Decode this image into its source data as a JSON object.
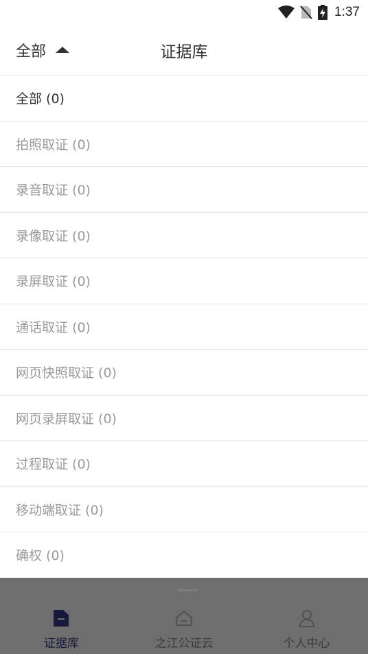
{
  "status_bar": {
    "time": "1:37"
  },
  "header": {
    "filter_label": "全部",
    "title": "证据库"
  },
  "filter_options": [
    {
      "label": "全部 (0)",
      "active": true
    },
    {
      "label": "拍照取证 (0)",
      "active": false
    },
    {
      "label": "录音取证 (0)",
      "active": false
    },
    {
      "label": "录像取证 (0)",
      "active": false
    },
    {
      "label": "录屏取证 (0)",
      "active": false
    },
    {
      "label": "通话取证 (0)",
      "active": false
    },
    {
      "label": "网页快照取证 (0)",
      "active": false
    },
    {
      "label": "网页录屏取证 (0)",
      "active": false
    },
    {
      "label": "过程取证 (0)",
      "active": false
    },
    {
      "label": "移动端取证 (0)",
      "active": false
    },
    {
      "label": "确权 (0)",
      "active": false
    }
  ],
  "tabs": [
    {
      "label": "证据库",
      "icon": "folder-icon",
      "active": true
    },
    {
      "label": "之江公证云",
      "icon": "home-icon",
      "active": false
    },
    {
      "label": "个人中心",
      "icon": "person-icon",
      "active": false
    }
  ],
  "colors": {
    "active_tab": "#17193c",
    "inactive_text": "#9a9a9a",
    "active_text": "#333333",
    "overlay": "#6e6e6e"
  }
}
